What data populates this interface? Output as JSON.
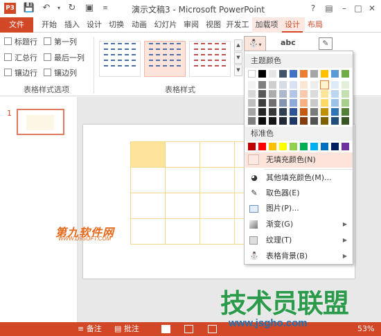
{
  "titlebar": {
    "app_icon": "P3",
    "title": "演示文稿3 - Microsoft PowerPoint",
    "question_mark": "?",
    "icons": [
      "save-icon",
      "undo-icon",
      "redo-icon",
      "presenter-icon",
      "toolbar-dropdown-icon"
    ]
  },
  "tabs": {
    "file": "文件",
    "home": "开始",
    "insert": "插入",
    "design": "设计",
    "transitions": "切换",
    "animations": "动画",
    "slideshow": "幻灯片",
    "review": "审阅",
    "view": "视图",
    "developer": "开发工",
    "addins": "加载项",
    "table_design": "设计",
    "table_layout": "布局"
  },
  "ribbon": {
    "style_options": {
      "header_row": "标题行",
      "first_column": "第一列",
      "total_row": "汇总行",
      "last_column": "最后一列",
      "banded_rows": "镶边行",
      "banded_columns": "镶边列",
      "group_label": "表格样式选项"
    },
    "table_styles": {
      "group_label": "表格样式"
    },
    "wordart": {
      "label": "abc"
    }
  },
  "thumbnail": {
    "slide_number": "1"
  },
  "shading_menu": {
    "theme_colors_label": "主题颜色",
    "standard_colors_label": "标准色",
    "no_fill": "无填充颜色(N)",
    "more_colors": "其他填充颜色(M)...",
    "eyedropper": "取色器(E)",
    "picture": "图片(P)...",
    "gradient": "渐变(G)",
    "texture": "纹理(T)",
    "table_background": "表格背景(B)",
    "theme_top_row": [
      "#ffffff",
      "#000000",
      "#e7e6e6",
      "#44546a",
      "#4472c4",
      "#ed7d31",
      "#a5a5a5",
      "#ffc000",
      "#5b9bd5",
      "#70ad47"
    ],
    "theme_shades": [
      [
        "#f2f2f2",
        "#7f7f7f",
        "#d0cece",
        "#d6dce4",
        "#d9e2f3",
        "#fbe5d5",
        "#ededed",
        "#fff2cc",
        "#deebf6",
        "#e2efd9"
      ],
      [
        "#d8d8d8",
        "#595959",
        "#aeabab",
        "#adb9ca",
        "#b4c6e7",
        "#f7cbac",
        "#dbdbdb",
        "#fee599",
        "#bdd7ee",
        "#c5e0b3"
      ],
      [
        "#bfbfbf",
        "#3f3f3f",
        "#757070",
        "#8496b0",
        "#8eaadb",
        "#f4b183",
        "#c9c9c9",
        "#ffd965",
        "#9cc3e5",
        "#a8d08d"
      ],
      [
        "#a5a5a5",
        "#262626",
        "#3a3838",
        "#323f4f",
        "#2f5496",
        "#c55a11",
        "#7b7b7b",
        "#bf9000",
        "#2e75b5",
        "#538135"
      ],
      [
        "#7f7f7f",
        "#0c0c0c",
        "#171616",
        "#222a35",
        "#1f3864",
        "#833c0b",
        "#525252",
        "#7f6000",
        "#1e4e79",
        "#375623"
      ]
    ],
    "selected_swatch": "#fff2cc",
    "standard_colors": [
      "#c00000",
      "#ff0000",
      "#ffc000",
      "#ffff00",
      "#92d050",
      "#00b050",
      "#00b0f0",
      "#0070c0",
      "#002060",
      "#7030a0"
    ]
  },
  "statusbar": {
    "notes": "备注",
    "comments": "批注",
    "zoom": "53%"
  },
  "watermarks": {
    "left_logo": "第九软件网",
    "left_url": "WWW.D9SOFT.COM",
    "right_logo": "技术员联盟",
    "right_url": "www.jsgho.com"
  },
  "colors": {
    "accent": "#d24726",
    "table_border": "#f6d88a",
    "table_highlight": "#fde49a"
  }
}
